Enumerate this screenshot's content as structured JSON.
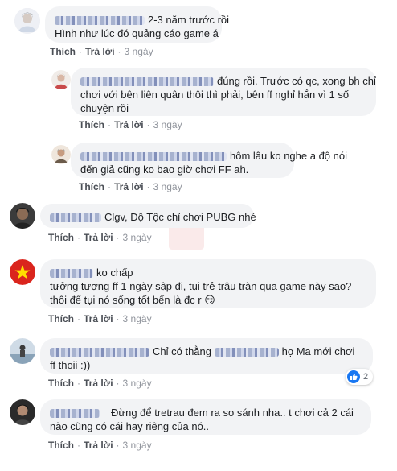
{
  "actions": {
    "like": "Thích",
    "reply": "Trả lời",
    "sep": "·"
  },
  "comments": [
    {
      "time": "3 ngày",
      "text_line1": "2-3 năm trước rồi",
      "text_line2": "Hình như lúc đó quảng cáo game á"
    },
    {
      "time": "3 ngày",
      "text_line1": "đúng rồi. Trước có qc, xong bh chỉ",
      "text_line2": "chơi với bên liên quân thôi thì phải, bên ff nghỉ hẳn vì 1 số",
      "text_line3": "chuyện rồi"
    },
    {
      "time": "3 ngày",
      "text_line1": "hôm lâu ko nghe a độ nói",
      "text_line2": "đến giả cũng ko bao giờ chơi FF ah."
    },
    {
      "time": "3 ngày",
      "text_line1": "Clgv, Độ Tộc chỉ chơi PUBG nhé"
    },
    {
      "time": "3 ngày",
      "text_line1": "ko chấp",
      "text_line2": "tưởng tượng ff 1 ngày sập đi, tụi trẻ trâu tràn qua game này sao?",
      "text_line3": "thôi để tụi nó sống tốt bến là đc r 😏"
    },
    {
      "time": "3 ngày",
      "text_line1": "Chỉ có thằng",
      "text_line1b": "họ Ma mới chơi",
      "text_line2": "ff thoii :))",
      "likes": "2"
    },
    {
      "time": "3 ngày",
      "text_line1": "Đừng để tretrau đem ra so sánh nha.. t chơi cả 2 cái",
      "text_line2": "nào cũng có cái hay riêng của nó.."
    }
  ],
  "colors": {
    "bubble": "#f2f3f5",
    "like_blue": "#1877f2",
    "link": "#4b4f56",
    "time": "#90949c"
  },
  "icons": [
    "avatar",
    "like-thumb-icon",
    "vietnam-flag-avatar",
    "smirk-emoji"
  ]
}
